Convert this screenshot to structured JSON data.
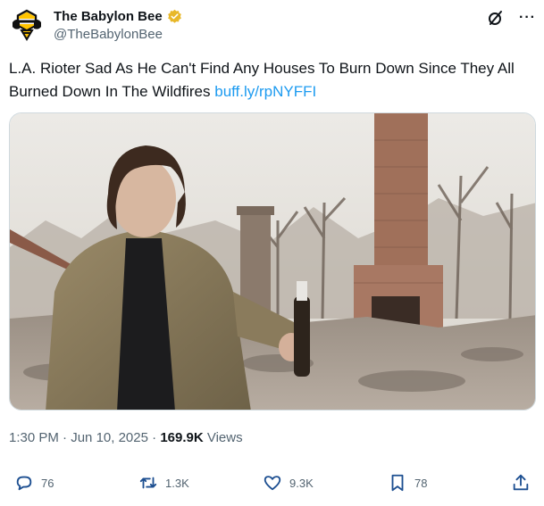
{
  "author": {
    "display_name": "The Babylon Bee",
    "handle": "@TheBabylonBee",
    "verified": true,
    "brand_color": "#ffc300",
    "avatar_icon": "bee-logo-icon"
  },
  "tweet": {
    "text": "L.A. Rioter Sad As He Can't Find Any Houses To Burn Down Since They All Burned Down In The Wildfires ",
    "link": "buff.ly/rpNYFFI",
    "link_color": "#1d9bf0"
  },
  "media": {
    "description_icon": "photo-image"
  },
  "meta": {
    "time": "1:30 PM",
    "separator": "·",
    "date": "Jun 10, 2025",
    "views_count": "169.9K",
    "views_label": "Views"
  },
  "actions": {
    "replies": "76",
    "reposts": "1.3K",
    "likes": "9.3K",
    "bookmarks": "78"
  }
}
